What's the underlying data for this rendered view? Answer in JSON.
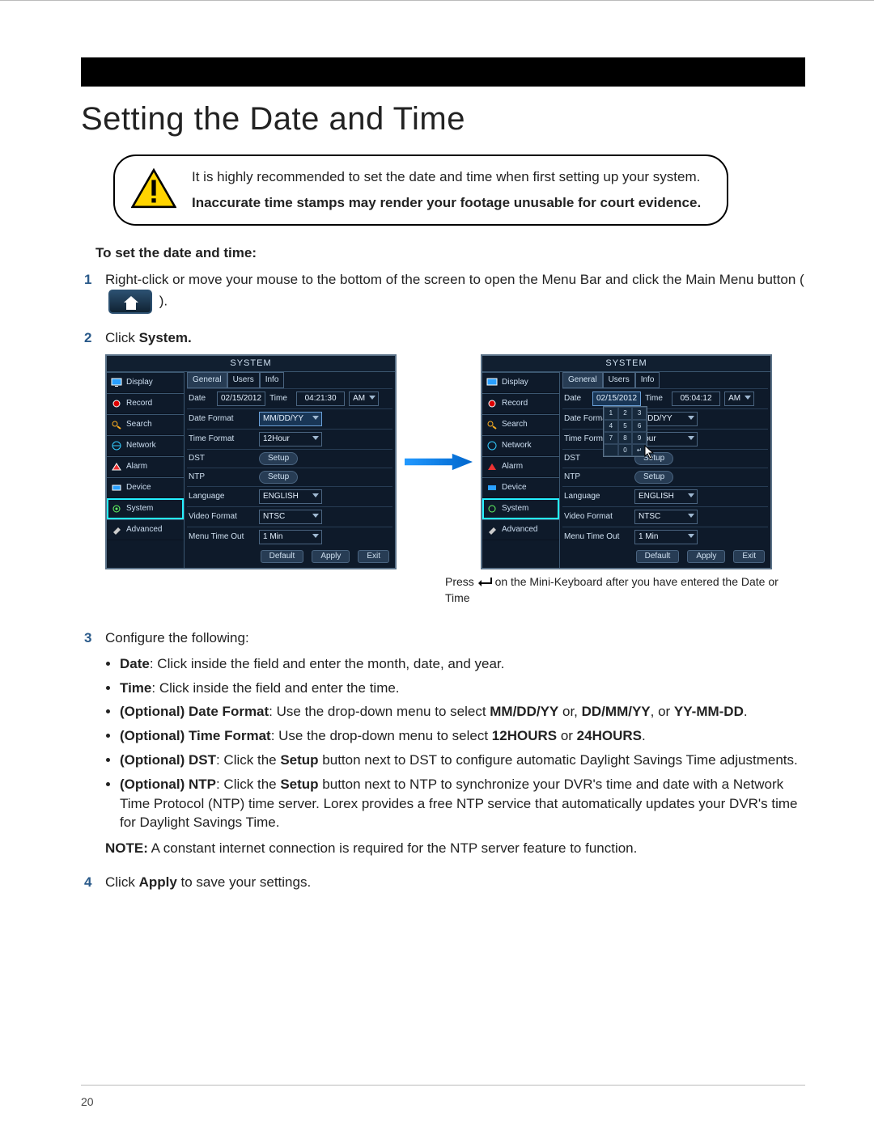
{
  "page_number": "20",
  "title": "Setting the Date and Time",
  "note_box": {
    "line1": "It is highly recommended to set the date and time when first setting up your system.",
    "line2_bold": "Inaccurate time stamps may render your footage unusable for court evidence."
  },
  "instr_heading": "To set the date and time:",
  "steps": {
    "s1": {
      "num": "1",
      "text_a": "Right-click or move your mouse to the bottom of the screen to open the Menu Bar and click the Main Menu button ( ",
      "text_b": " )."
    },
    "s2": {
      "num": "2",
      "text_a": "Click ",
      "text_b": "System."
    },
    "s3": {
      "num": "3",
      "text": "Configure the following:",
      "bullets": {
        "b1": {
          "lead": "Date",
          "rest": ": Click inside the field and enter the month, date, and year."
        },
        "b2": {
          "lead": "Time",
          "rest": ": Click inside the field and enter the time."
        },
        "b3": {
          "lead": "(Optional) Date Format",
          "rest": ": Use the drop-down menu to select ",
          "opt1": "MM/DD/YY",
          "mid1": " or, ",
          "opt2": "DD/MM/YY",
          "mid2": ", or ",
          "opt3": "YY-MM-DD",
          "tail": "."
        },
        "b4": {
          "lead": "(Optional) Time Format",
          "rest": ": Use the drop-down menu to select ",
          "opt1": "12HOURS",
          "mid": " or ",
          "opt2": "24HOURS",
          "tail": "."
        },
        "b5": {
          "lead": "(Optional) DST",
          "rest": ": Click the ",
          "btn": "Setup",
          "tail": " button next to DST to configure automatic Daylight Savings Time adjustments."
        },
        "b6": {
          "lead": "(Optional) NTP",
          "rest": ": Click the ",
          "btn": "Setup",
          "tail": " button next to NTP to synchronize your DVR's time and date with a Network Time Protocol (NTP) time server. Lorex provides a free NTP service that automatically updates your DVR's time for Daylight Savings Time."
        }
      },
      "note_lead": "NOTE:",
      "note_rest": " A constant internet connection is required for the NTP server feature to function."
    },
    "s4": {
      "num": "4",
      "text_a": "Click ",
      "text_b": "Apply",
      "text_c": " to save your settings."
    }
  },
  "caption": {
    "a": "Press ",
    "b": " on the Mini-Keyboard after you have entered the Date or Time"
  },
  "system_ui": {
    "title": "SYSTEM",
    "side": [
      "Display",
      "Record",
      "Search",
      "Network",
      "Alarm",
      "Device",
      "System",
      "Advanced"
    ],
    "tabs": [
      "General",
      "Users",
      "Info"
    ],
    "labels": {
      "date": "Date",
      "time": "Time",
      "date_format": "Date Format",
      "time_format": "Time Format",
      "dst": "DST",
      "ntp": "NTP",
      "language": "Language",
      "video_format": "Video Format",
      "menu_timeout": "Menu Time Out"
    },
    "left_values": {
      "date": "02/15/2012",
      "time": "04:21:30",
      "ampm": "AM",
      "date_format": "MM/DD/YY",
      "time_format": "12Hour",
      "setup": "Setup",
      "language": "ENGLISH",
      "video_format": "NTSC",
      "menu_timeout": "1 Min"
    },
    "right_values": {
      "date": "02/15/2012",
      "time": "05:04:12",
      "ampm": "AM",
      "date_format": "M/DD/YY",
      "time_format": "Hour",
      "setup": "Setup",
      "language": "ENGLISH",
      "video_format": "NTSC",
      "menu_timeout": "1 Min"
    },
    "buttons": {
      "default": "Default",
      "apply": "Apply",
      "exit": "Exit"
    }
  }
}
